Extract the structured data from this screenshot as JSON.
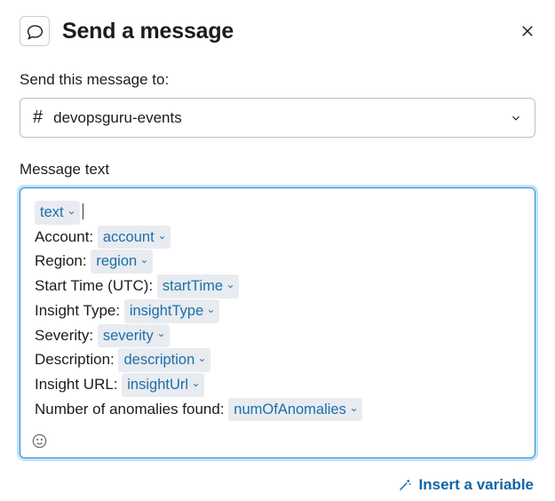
{
  "header": {
    "title": "Send a message"
  },
  "sendTo": {
    "label": "Send this message to:",
    "channel": "devopsguru-events"
  },
  "messageText": {
    "label": "Message text",
    "lines": [
      {
        "prefix": "",
        "variable": "text"
      },
      {
        "prefix": "Account: ",
        "variable": "account"
      },
      {
        "prefix": "Region: ",
        "variable": "region"
      },
      {
        "prefix": "Start Time (UTC): ",
        "variable": "startTime"
      },
      {
        "prefix": "Insight Type: ",
        "variable": "insightType"
      },
      {
        "prefix": "Severity: ",
        "variable": "severity"
      },
      {
        "prefix": "Description: ",
        "variable": "description"
      },
      {
        "prefix": "Insight URL: ",
        "variable": "insightUrl"
      },
      {
        "prefix": "Number of anomalies found: ",
        "variable": "numOfAnomalies"
      }
    ]
  },
  "footer": {
    "insertVariable": "Insert a variable"
  }
}
